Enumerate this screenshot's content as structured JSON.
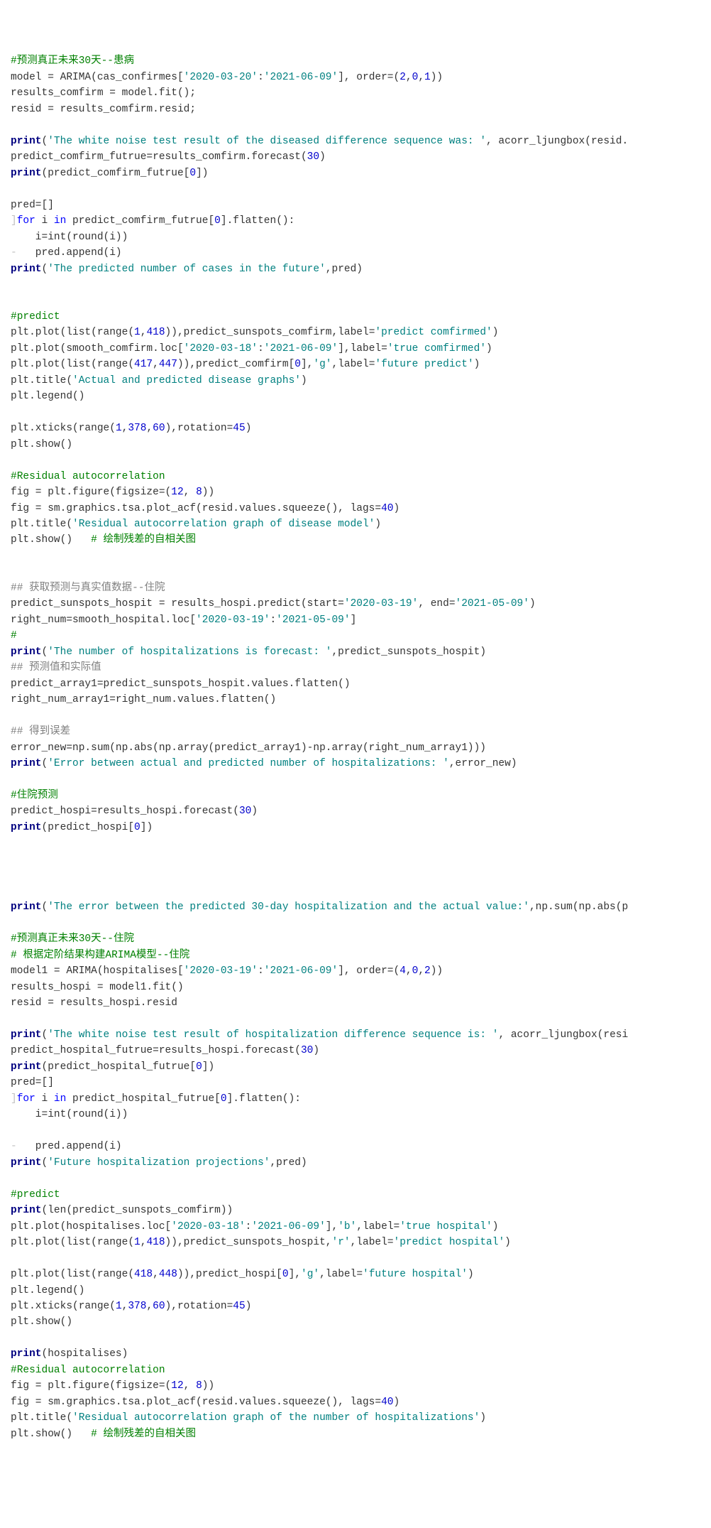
{
  "lines": [
    [
      {
        "t": "#预测真正未来30天--患病",
        "cls": "c"
      }
    ],
    [
      {
        "t": "model = ARIMA(cas_confirmes["
      },
      {
        "t": "'2020-03-20'",
        "cls": "s"
      },
      {
        "t": ":"
      },
      {
        "t": "'2021-06-09'",
        "cls": "s"
      },
      {
        "t": "], order=("
      },
      {
        "t": "2",
        "cls": "p"
      },
      {
        "t": ","
      },
      {
        "t": "0",
        "cls": "p"
      },
      {
        "t": ","
      },
      {
        "t": "1",
        "cls": "p"
      },
      {
        "t": "))"
      }
    ],
    [
      {
        "t": "results_comfirm = model.fit();"
      }
    ],
    [
      {
        "t": "resid = results_comfirm.resid;"
      }
    ],
    [
      {
        "t": ""
      }
    ],
    [
      {
        "t": "print",
        "cls": "kb"
      },
      {
        "t": "("
      },
      {
        "t": "'The white noise test result of the diseased difference sequence was: '",
        "cls": "s"
      },
      {
        "t": ", acorr_ljungbox(resid."
      }
    ],
    [
      {
        "t": "predict_comfirm_futrue=results_comfirm.forecast("
      },
      {
        "t": "30",
        "cls": "p"
      },
      {
        "t": ")"
      }
    ],
    [
      {
        "t": "print",
        "cls": "kb"
      },
      {
        "t": "(predict_comfirm_futrue["
      },
      {
        "t": "0",
        "cls": "p"
      },
      {
        "t": "])"
      }
    ],
    [
      {
        "t": ""
      }
    ],
    [
      {
        "t": "pred=[]"
      }
    ],
    [
      {
        "t": "]",
        "cls": "gut"
      },
      {
        "t": "for",
        "cls": "k"
      },
      {
        "t": " i "
      },
      {
        "t": "in",
        "cls": "k"
      },
      {
        "t": " predict_comfirm_futrue["
      },
      {
        "t": "0",
        "cls": "p"
      },
      {
        "t": "].flatten():"
      }
    ],
    [
      {
        "t": "    i=int(round(i))"
      }
    ],
    [
      {
        "t": "-",
        "cls": "gut"
      },
      {
        "t": "   pred.append(i)"
      }
    ],
    [
      {
        "t": "print",
        "cls": "kb"
      },
      {
        "t": "("
      },
      {
        "t": "'The predicted number of cases in the future'",
        "cls": "s"
      },
      {
        "t": ",pred)"
      }
    ],
    [
      {
        "t": ""
      }
    ],
    [
      {
        "t": ""
      }
    ],
    [
      {
        "t": "#predict",
        "cls": "c"
      }
    ],
    [
      {
        "t": "plt.plot(list(range("
      },
      {
        "t": "1",
        "cls": "p"
      },
      {
        "t": ","
      },
      {
        "t": "418",
        "cls": "p"
      },
      {
        "t": ")),predict_sunspots_comfirm,label="
      },
      {
        "t": "'predict comfirmed'",
        "cls": "s"
      },
      {
        "t": ")"
      }
    ],
    [
      {
        "t": "plt.plot(smooth_comfirm.loc["
      },
      {
        "t": "'2020-03-18'",
        "cls": "s"
      },
      {
        "t": ":"
      },
      {
        "t": "'2021-06-09'",
        "cls": "s"
      },
      {
        "t": "],label="
      },
      {
        "t": "'true comfirmed'",
        "cls": "s"
      },
      {
        "t": ")"
      }
    ],
    [
      {
        "t": "plt.plot(list(range("
      },
      {
        "t": "417",
        "cls": "p"
      },
      {
        "t": ","
      },
      {
        "t": "447",
        "cls": "p"
      },
      {
        "t": ")),predict_comfirm["
      },
      {
        "t": "0",
        "cls": "p"
      },
      {
        "t": "],"
      },
      {
        "t": "'g'",
        "cls": "s"
      },
      {
        "t": ",label="
      },
      {
        "t": "'future predict'",
        "cls": "s"
      },
      {
        "t": ")"
      }
    ],
    [
      {
        "t": "plt.title("
      },
      {
        "t": "'Actual and predicted disease graphs'",
        "cls": "s"
      },
      {
        "t": ")"
      }
    ],
    [
      {
        "t": "plt.legend()"
      }
    ],
    [
      {
        "t": ""
      }
    ],
    [
      {
        "t": "plt.xticks(range("
      },
      {
        "t": "1",
        "cls": "p"
      },
      {
        "t": ","
      },
      {
        "t": "378",
        "cls": "p"
      },
      {
        "t": ","
      },
      {
        "t": "60",
        "cls": "p"
      },
      {
        "t": "),rotation="
      },
      {
        "t": "45",
        "cls": "p"
      },
      {
        "t": ")"
      }
    ],
    [
      {
        "t": "plt.show()"
      }
    ],
    [
      {
        "t": ""
      }
    ],
    [
      {
        "t": "#Residual autocorrelation",
        "cls": "c"
      }
    ],
    [
      {
        "t": "fig = plt.figure(figsize=("
      },
      {
        "t": "12",
        "cls": "p"
      },
      {
        "t": ", "
      },
      {
        "t": "8",
        "cls": "p"
      },
      {
        "t": "))"
      }
    ],
    [
      {
        "t": "fig = sm.graphics.tsa.plot_acf(resid.values.squeeze(), lags="
      },
      {
        "t": "40",
        "cls": "p"
      },
      {
        "t": ")"
      }
    ],
    [
      {
        "t": "plt.title("
      },
      {
        "t": "'Residual autocorrelation graph of disease model'",
        "cls": "s"
      },
      {
        "t": ")"
      }
    ],
    [
      {
        "t": "plt.show()   "
      },
      {
        "t": "# 绘制残差的自相关图",
        "cls": "c"
      }
    ],
    [
      {
        "t": ""
      }
    ],
    [
      {
        "t": ""
      }
    ],
    [
      {
        "t": "## 获取预测与真实值数据--住院",
        "cls": "cg"
      }
    ],
    [
      {
        "t": "predict_sunspots_hospit = results_hospi.predict(start="
      },
      {
        "t": "'2020-03-19'",
        "cls": "s"
      },
      {
        "t": ", end="
      },
      {
        "t": "'2021-05-09'",
        "cls": "s"
      },
      {
        "t": ")"
      }
    ],
    [
      {
        "t": "right_num=smooth_hospital.loc["
      },
      {
        "t": "'2020-03-19'",
        "cls": "s"
      },
      {
        "t": ":"
      },
      {
        "t": "'2021-05-09'",
        "cls": "s"
      },
      {
        "t": "]"
      }
    ],
    [
      {
        "t": "#",
        "cls": "c"
      }
    ],
    [
      {
        "t": "print",
        "cls": "kb"
      },
      {
        "t": "("
      },
      {
        "t": "'The number of hospitalizations is forecast: '",
        "cls": "s"
      },
      {
        "t": ",predict_sunspots_hospit)"
      }
    ],
    [
      {
        "t": "## 预测值和实际值",
        "cls": "cg"
      }
    ],
    [
      {
        "t": "predict_array1=predict_sunspots_hospit.values.flatten()"
      }
    ],
    [
      {
        "t": "right_num_array1=right_num.values.flatten()"
      }
    ],
    [
      {
        "t": ""
      }
    ],
    [
      {
        "t": "## 得到误差",
        "cls": "cg"
      }
    ],
    [
      {
        "t": "error_new=np.sum(np.abs(np.array(predict_array1)-np.array(right_num_array1)))"
      }
    ],
    [
      {
        "t": "print",
        "cls": "kb"
      },
      {
        "t": "("
      },
      {
        "t": "'Error between actual and predicted number of hospitalizations: '",
        "cls": "s"
      },
      {
        "t": ",error_new)"
      }
    ],
    [
      {
        "t": ""
      }
    ],
    [
      {
        "t": "#住院预测",
        "cls": "c"
      }
    ],
    [
      {
        "t": "predict_hospi=results_hospi.forecast("
      },
      {
        "t": "30",
        "cls": "p"
      },
      {
        "t": ")"
      }
    ],
    [
      {
        "t": "print",
        "cls": "kb"
      },
      {
        "t": "(predict_hospi["
      },
      {
        "t": "0",
        "cls": "p"
      },
      {
        "t": "])"
      }
    ],
    [
      {
        "t": ""
      }
    ],
    [
      {
        "t": ""
      }
    ],
    [
      {
        "t": ""
      }
    ],
    [
      {
        "t": ""
      }
    ],
    [
      {
        "t": "print",
        "cls": "kb"
      },
      {
        "t": "("
      },
      {
        "t": "'The error between the predicted 30-day hospitalization and the actual value:'",
        "cls": "s"
      },
      {
        "t": ",np.sum(np.abs(p"
      }
    ],
    [
      {
        "t": ""
      }
    ],
    [
      {
        "t": "#预测真正未来30天--住院",
        "cls": "c"
      }
    ],
    [
      {
        "t": "# 根据定阶结果构建ARIMA模型--住院",
        "cls": "c"
      }
    ],
    [
      {
        "t": "model1 = ARIMA(hospitalises["
      },
      {
        "t": "'2020-03-19'",
        "cls": "s"
      },
      {
        "t": ":"
      },
      {
        "t": "'2021-06-09'",
        "cls": "s"
      },
      {
        "t": "], order=("
      },
      {
        "t": "4",
        "cls": "p"
      },
      {
        "t": ","
      },
      {
        "t": "0",
        "cls": "p"
      },
      {
        "t": ","
      },
      {
        "t": "2",
        "cls": "p"
      },
      {
        "t": "))"
      }
    ],
    [
      {
        "t": "results_hospi = model1.fit()"
      }
    ],
    [
      {
        "t": "resid = results_hospi.resid"
      }
    ],
    [
      {
        "t": ""
      }
    ],
    [
      {
        "t": "print",
        "cls": "kb"
      },
      {
        "t": "("
      },
      {
        "t": "'The white noise test result of hospitalization difference sequence is: '",
        "cls": "s"
      },
      {
        "t": ", acorr_ljungbox(resi"
      }
    ],
    [
      {
        "t": "predict_hospital_futrue=results_hospi.forecast("
      },
      {
        "t": "30",
        "cls": "p"
      },
      {
        "t": ")"
      }
    ],
    [
      {
        "t": "print",
        "cls": "kb"
      },
      {
        "t": "(predict_hospital_futrue["
      },
      {
        "t": "0",
        "cls": "p"
      },
      {
        "t": "])"
      }
    ],
    [
      {
        "t": "pred=[]"
      }
    ],
    [
      {
        "t": "]",
        "cls": "gut"
      },
      {
        "t": "for",
        "cls": "k"
      },
      {
        "t": " i "
      },
      {
        "t": "in",
        "cls": "k"
      },
      {
        "t": " predict_hospital_futrue["
      },
      {
        "t": "0",
        "cls": "p"
      },
      {
        "t": "].flatten():"
      }
    ],
    [
      {
        "t": "    i=int(round(i))"
      }
    ],
    [
      {
        "t": ""
      }
    ],
    [
      {
        "t": "-",
        "cls": "gut"
      },
      {
        "t": "   pred.append(i)"
      }
    ],
    [
      {
        "t": "print",
        "cls": "kb"
      },
      {
        "t": "("
      },
      {
        "t": "'Future hospitalization projections'",
        "cls": "s"
      },
      {
        "t": ",pred)"
      }
    ],
    [
      {
        "t": ""
      }
    ],
    [
      {
        "t": "#predict",
        "cls": "c"
      }
    ],
    [
      {
        "t": "print",
        "cls": "kb"
      },
      {
        "t": "(len(predict_sunspots_comfirm))"
      }
    ],
    [
      {
        "t": "plt.plot(hospitalises.loc["
      },
      {
        "t": "'2020-03-18'",
        "cls": "s"
      },
      {
        "t": ":"
      },
      {
        "t": "'2021-06-09'",
        "cls": "s"
      },
      {
        "t": "],"
      },
      {
        "t": "'b'",
        "cls": "s"
      },
      {
        "t": ",label="
      },
      {
        "t": "'true hospital'",
        "cls": "s"
      },
      {
        "t": ")"
      }
    ],
    [
      {
        "t": "plt.plot(list(range("
      },
      {
        "t": "1",
        "cls": "p"
      },
      {
        "t": ","
      },
      {
        "t": "418",
        "cls": "p"
      },
      {
        "t": ")),predict_sunspots_hospit,"
      },
      {
        "t": "'r'",
        "cls": "s"
      },
      {
        "t": ",label="
      },
      {
        "t": "'predict hospital'",
        "cls": "s"
      },
      {
        "t": ")"
      }
    ],
    [
      {
        "t": ""
      }
    ],
    [
      {
        "t": "plt.plot(list(range("
      },
      {
        "t": "418",
        "cls": "p"
      },
      {
        "t": ","
      },
      {
        "t": "448",
        "cls": "p"
      },
      {
        "t": ")),predict_hospi["
      },
      {
        "t": "0",
        "cls": "p"
      },
      {
        "t": "],"
      },
      {
        "t": "'g'",
        "cls": "s"
      },
      {
        "t": ",label="
      },
      {
        "t": "'future hospital'",
        "cls": "s"
      },
      {
        "t": ")"
      }
    ],
    [
      {
        "t": "plt.legend()"
      }
    ],
    [
      {
        "t": "plt.xticks(range("
      },
      {
        "t": "1",
        "cls": "p"
      },
      {
        "t": ","
      },
      {
        "t": "378",
        "cls": "p"
      },
      {
        "t": ","
      },
      {
        "t": "60",
        "cls": "p"
      },
      {
        "t": "),rotation="
      },
      {
        "t": "45",
        "cls": "p"
      },
      {
        "t": ")"
      }
    ],
    [
      {
        "t": "plt.show()"
      }
    ],
    [
      {
        "t": ""
      }
    ],
    [
      {
        "t": "print",
        "cls": "kb"
      },
      {
        "t": "(hospitalises)"
      }
    ],
    [
      {
        "t": "#Residual autocorrelation",
        "cls": "c"
      }
    ],
    [
      {
        "t": "fig = plt.figure(figsize=("
      },
      {
        "t": "12",
        "cls": "p"
      },
      {
        "t": ", "
      },
      {
        "t": "8",
        "cls": "p"
      },
      {
        "t": "))"
      }
    ],
    [
      {
        "t": "fig = sm.graphics.tsa.plot_acf(resid.values.squeeze(), lags="
      },
      {
        "t": "40",
        "cls": "p"
      },
      {
        "t": ")"
      }
    ],
    [
      {
        "t": "plt.title("
      },
      {
        "t": "'Residual autocorrelation graph of the number of hospitalizations'",
        "cls": "s"
      },
      {
        "t": ")"
      }
    ],
    [
      {
        "t": "plt.show()   "
      },
      {
        "t": "# 绘制残差的自相关图",
        "cls": "c"
      }
    ]
  ]
}
